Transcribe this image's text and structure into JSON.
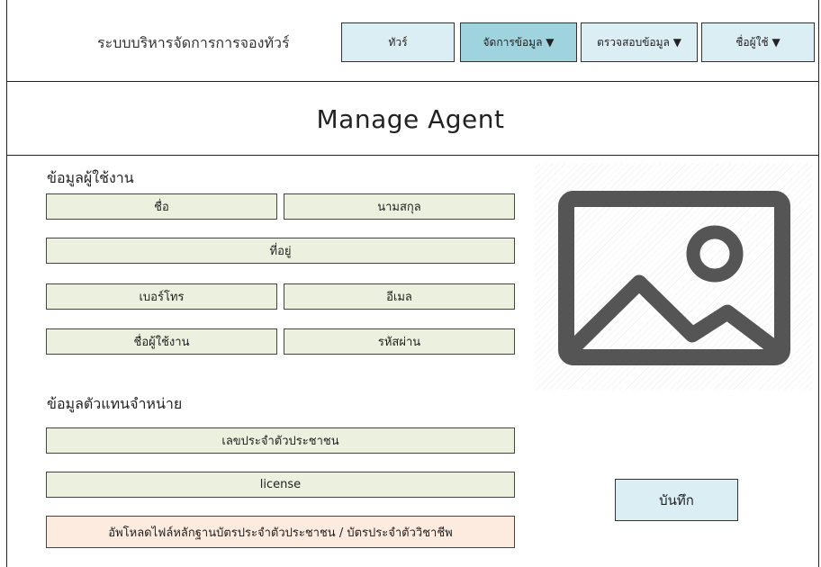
{
  "header": {
    "app_title": "ระบบบริหารจัดการการจองทัวร์",
    "nav": {
      "tours": "ทัวร์",
      "manage_data": "จัดการข้อมูล ▼",
      "check_data": "ตรวจสอบข้อมูล ▼",
      "username": "ชื่อผู้ใช้ ▼"
    }
  },
  "page": {
    "title": "Manage Agent"
  },
  "user_info": {
    "heading": "ข้อมูลผู้ใช้งาน",
    "first_name": "ชื่อ",
    "last_name": "นามสกุล",
    "address": "ที่อยู่",
    "phone": "เบอร์โทร",
    "email": "อีเมล",
    "username": "ชื่อผู้ใช้งาน",
    "password": "รหัสผ่าน"
  },
  "agent_info": {
    "heading": "ข้อมูลตัวแทนจำหน่าย",
    "id_card": "เลขประจำตัวประชาชน",
    "license": "license",
    "upload": "อัพโหลดไฟล์หลักฐานบัตรประจำตัวประชาชน / บัตรประจำตัววิชาชีพ"
  },
  "actions": {
    "save": "บันทึก"
  },
  "icons": {
    "image_placeholder": "image-icon"
  },
  "colors": {
    "nav_bg": "#dbeef4",
    "nav_active_bg": "#9fd3de",
    "field_bg": "#ebf1de",
    "upload_bg": "#fdebe0",
    "icon_gray": "#555555"
  }
}
